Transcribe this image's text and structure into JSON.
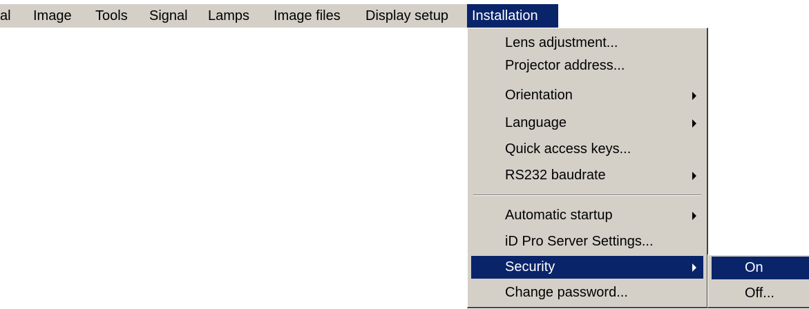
{
  "menubar": {
    "items": [
      {
        "label": "al"
      },
      {
        "label": "Image"
      },
      {
        "label": "Tools"
      },
      {
        "label": "Signal"
      },
      {
        "label": "Lamps"
      },
      {
        "label": "Image files"
      },
      {
        "label": "Display setup"
      },
      {
        "label": "Installation"
      }
    ]
  },
  "installation_menu": {
    "items": [
      {
        "label": "Lens adjustment...",
        "submenu": false
      },
      {
        "label": "Projector address...",
        "submenu": false
      },
      {
        "label": "Orientation",
        "submenu": true
      },
      {
        "label": "Language",
        "submenu": true
      },
      {
        "label": "Quick access keys...",
        "submenu": false
      },
      {
        "label": "RS232 baudrate",
        "submenu": true
      },
      {
        "label": "Automatic startup",
        "submenu": true
      },
      {
        "label": "iD Pro Server Settings...",
        "submenu": false
      },
      {
        "label": "Security",
        "submenu": true,
        "highlighted": true
      },
      {
        "label": "Change password...",
        "submenu": false
      }
    ]
  },
  "security_submenu": {
    "items": [
      {
        "label": "On",
        "highlighted": true
      },
      {
        "label": "Off..."
      }
    ]
  },
  "colors": {
    "menu_background": "#d4d0c8",
    "highlight": "#0a246a",
    "highlight_text": "#ffffff"
  }
}
